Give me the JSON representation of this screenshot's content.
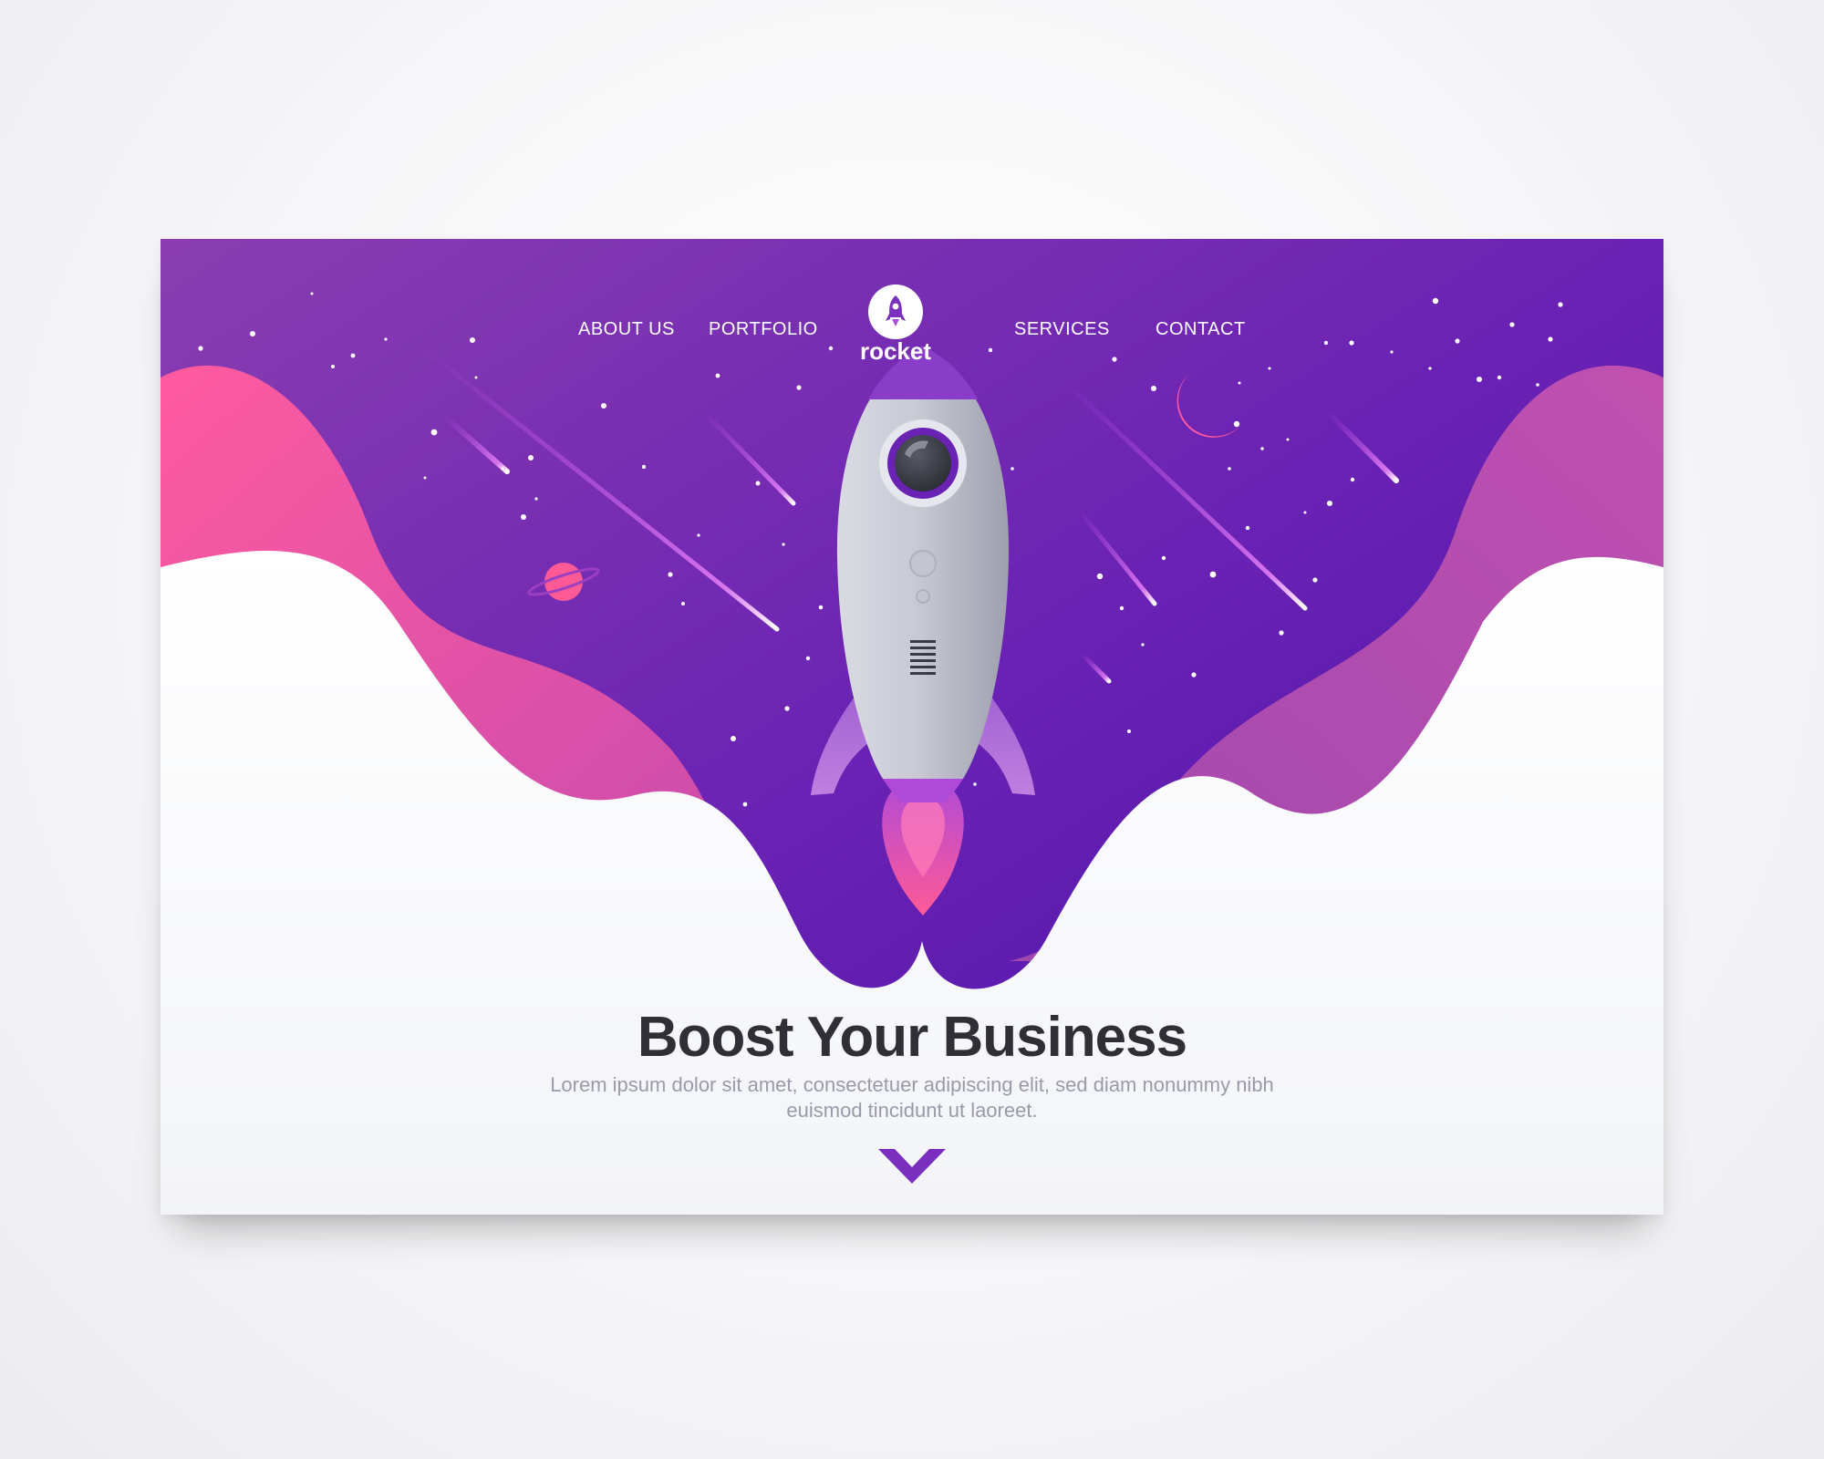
{
  "nav": {
    "about": "ABOUT US",
    "portfolio": "PORTFOLIO",
    "services": "SERVICES",
    "contact": "CONTACT"
  },
  "logo": {
    "text": "rocket",
    "icon": "rocket-icon"
  },
  "hero": {
    "headline": "Boost Your Business",
    "subtext": "Lorem ipsum dolor sit amet, consectetuer adipiscing elit, sed diam nonummy nibh euismod tincidunt ut laoreet."
  },
  "scroll": {
    "icon": "chevron-down-icon"
  },
  "colors": {
    "space_top": "#8a3db0",
    "space_bottom": "#4a14a8",
    "pink_wave": "#ff5aa0",
    "magenta_wave": "#b44aae",
    "accent_purple": "#7b2fbf",
    "headline": "#2f2f35",
    "subtext": "#9a9aa8"
  }
}
